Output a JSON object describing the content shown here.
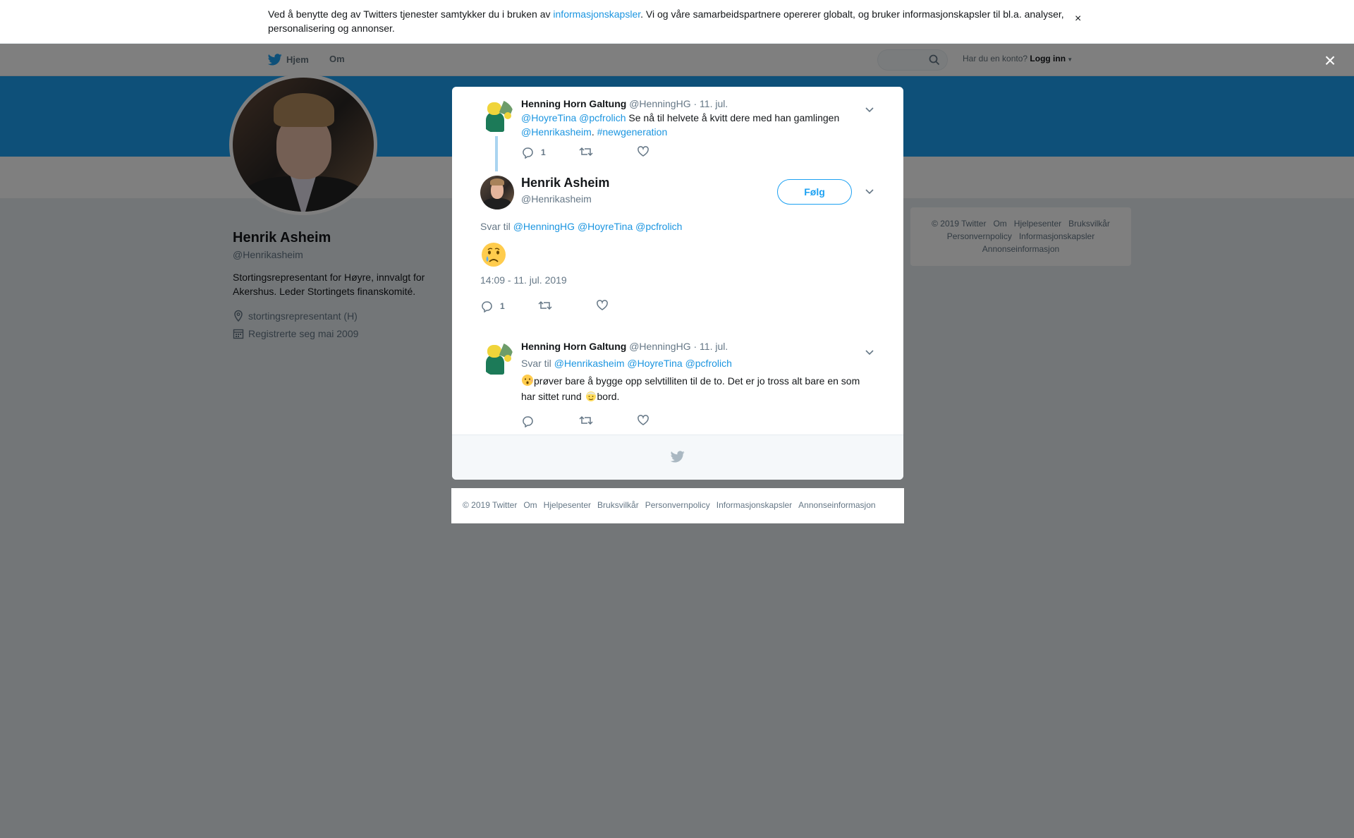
{
  "cookie_banner": {
    "text_before": "Ved å benytte deg av Twitters tjenester samtykker du i bruken av ",
    "link": "informasjonskapsler",
    "text_after": ". Vi og våre samarbeidspartnere opererer globalt, og bruker informasjonskapsler til bl.a. analyser, personalisering og annonser.",
    "close": "×"
  },
  "nav": {
    "home": "Hjem",
    "about": "Om",
    "login_prompt": "Har du en konto?",
    "login": "Logg inn"
  },
  "profile": {
    "name": "Henrik Asheim",
    "handle": "@Henrikasheim",
    "bio": "Stortingsrepresentant for Høyre, innvalgt for Akershus. Leder Stortingets finanskomité.",
    "location": "stortingsrepresentant (H)",
    "joined": "Registrerte seg mai 2009"
  },
  "side_footer": [
    "© 2019 Twitter",
    "Om",
    "Hjelpesenter",
    "Bruksvilkår",
    "Personvernpolicy",
    "Informasjonskapsler",
    "Annonseinformasjon"
  ],
  "overlay_close": "×",
  "modal": {
    "tweet1": {
      "name": "Henning Horn Galtung",
      "handle": "@HenningHG",
      "sep": " · ",
      "date": "11. jul.",
      "mention1": "@HoyreTina",
      "mention2": "@pcfrolich",
      "text1": "Se nå til helvete å kvitt dere med han gamlingen",
      "mention3": "@Henrikasheim",
      "dot": ".",
      "hashtag": "#newgeneration",
      "reply_count": "1"
    },
    "main": {
      "name": "Henrik Asheim",
      "handle": "@Henrikasheim",
      "follow": "Følg",
      "reply_label": "Svar til",
      "reply_mentions": [
        "@HenningHG",
        "@HoyreTina",
        "@pcfrolich"
      ],
      "time": "14:09 - 11. jul. 2019",
      "reply_count": "1"
    },
    "tweet3": {
      "name": "Henning Horn Galtung",
      "handle": "@HenningHG",
      "sep": " · ",
      "date": "11. jul.",
      "reply_label": "Svar til",
      "reply_mentions": [
        "@Henrikasheim",
        "@HoyreTina",
        "@pcfrolich"
      ],
      "text_a": "prøver bare å bygge opp selvtilliten til de to. Det er jo tross alt bare en som har sittet rund ",
      "text_b": "bord."
    }
  },
  "bottom_footer": [
    "© 2019 Twitter",
    "Om",
    "Hjelpesenter",
    "Bruksvilkår",
    "Personvernpolicy",
    "Informasjonskapsler",
    "Annonseinformasjon"
  ],
  "colors": {
    "twitter_blue": "#1da1f2",
    "link": "#1b95e0",
    "banner": "#1da1f2",
    "muted": "#657786"
  }
}
